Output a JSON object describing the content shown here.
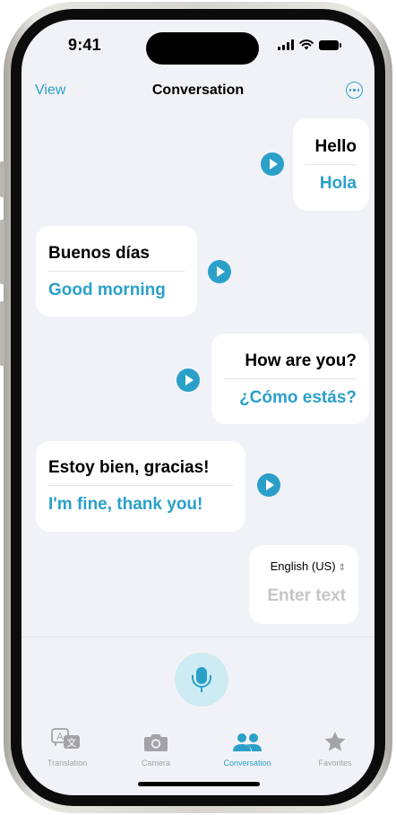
{
  "status_bar": {
    "time": "9:41"
  },
  "nav": {
    "left": "View",
    "title": "Conversation",
    "more_icon": "ellipsis-circle-icon"
  },
  "messages": [
    {
      "original": "Hello",
      "translation": "Hola",
      "side": "right"
    },
    {
      "original": "Buenos días",
      "translation": "Good morning",
      "side": "left"
    },
    {
      "original": "How are you?",
      "translation": "¿Cómo estás?",
      "side": "right"
    },
    {
      "original": "Estoy bien, gracias!",
      "translation": "I'm fine, thank you!",
      "side": "left"
    }
  ],
  "input": {
    "language": "English (US)",
    "placeholder": "Enter text"
  },
  "mic_icon": "microphone-icon",
  "tabs": [
    {
      "label": "Translation",
      "icon": "translate-icon",
      "active": false
    },
    {
      "label": "Camera",
      "icon": "camera-icon",
      "active": false
    },
    {
      "label": "Conversation",
      "icon": "people-icon",
      "active": true
    },
    {
      "label": "Favorites",
      "icon": "star-icon",
      "active": false
    }
  ],
  "colors": {
    "accent": "#2aa0c9",
    "background": "#f1f2f7",
    "mic_bg": "#cdebf2",
    "inactive": "#a2a2a7"
  }
}
